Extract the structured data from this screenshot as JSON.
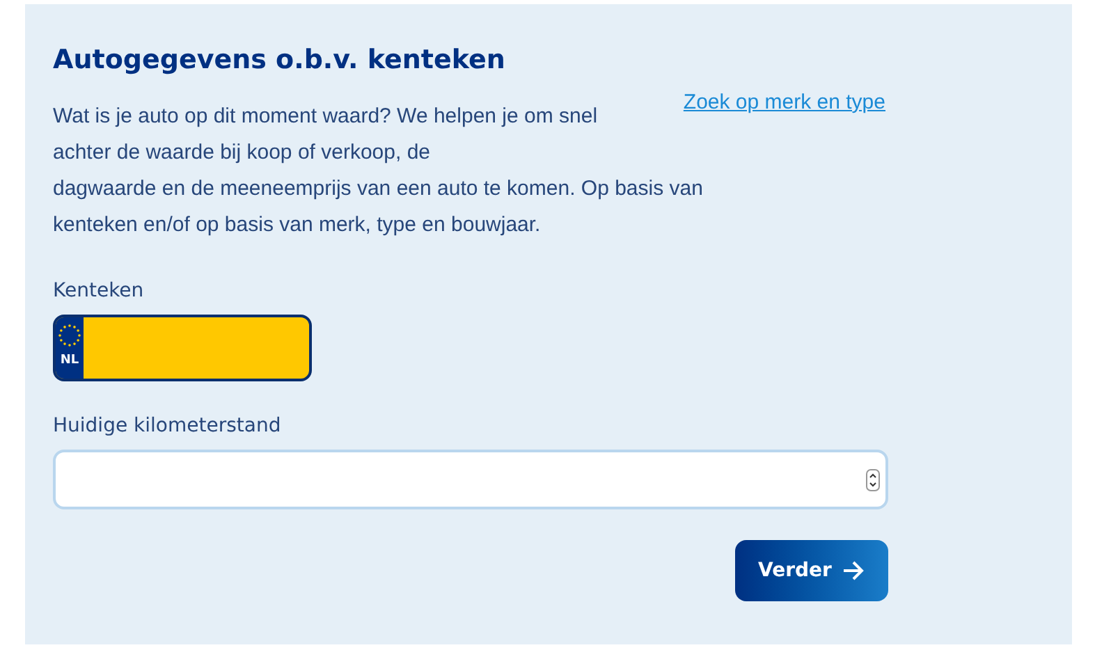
{
  "title": "Autogegevens o.b.v. kenteken",
  "link": "Zoek op merk en type",
  "intro": [
    "Wat is je auto op dit moment waard? We helpen je om snel achter de waarde bij koop of verkoop, de",
    "dagwaarde en de meeneemprijs van een auto te komen. Op basis van kenteken en/of op basis van merk, type en bouwjaar."
  ],
  "plate": {
    "label": "Kenteken",
    "country": "NL"
  },
  "mileage": {
    "label": "Huidige kilometerstand"
  },
  "button": "Verder"
}
